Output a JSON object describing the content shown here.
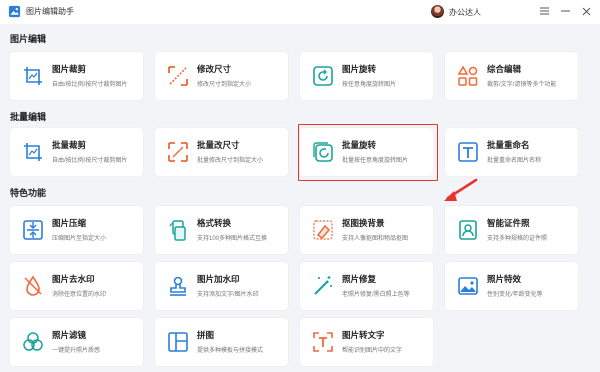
{
  "app": {
    "title": "图片编辑助手",
    "user": "办公达人"
  },
  "colors": {
    "accent_teal": "#1aa3a0",
    "accent_orange": "#f06a3a",
    "accent_blue": "#2b7fd8",
    "highlight": "#e8332e"
  },
  "sections": [
    {
      "title": "图片编辑"
    },
    {
      "title": "批量编辑"
    },
    {
      "title": "特色功能"
    }
  ],
  "cards": {
    "crop": {
      "title": "图片裁剪",
      "desc": "自由/按比例/按尺寸裁剪图片",
      "icon": "crop-icon"
    },
    "resize": {
      "title": "修改尺寸",
      "desc": "修改尺寸到指定大小",
      "icon": "resize-icon"
    },
    "rotate": {
      "title": "图片旋转",
      "desc": "按任意角度旋转图片",
      "icon": "rotate-icon"
    },
    "combo": {
      "title": "综合编辑",
      "desc": "裁剪/文字/滤镜等多个功能",
      "icon": "grid-shapes-icon"
    },
    "batch_crop": {
      "title": "批量裁剪",
      "desc": "自由/按比例/按尺寸裁剪图片",
      "icon": "crop-icon"
    },
    "batch_resize": {
      "title": "批量改尺寸",
      "desc": "批量修改尺寸到指定大小",
      "icon": "resize-icon"
    },
    "batch_rotate": {
      "title": "批量旋转",
      "desc": "批量按任意角度旋转图片",
      "icon": "rotate-icon"
    },
    "batch_rename": {
      "title": "批量重命名",
      "desc": "批量重命名图片名称",
      "icon": "text-t-icon"
    },
    "compress": {
      "title": "图片压缩",
      "desc": "压缩图片至指定大小",
      "icon": "compress-icon"
    },
    "convert": {
      "title": "格式转换",
      "desc": "支持100多种图片格式互换",
      "icon": "convert-icon"
    },
    "bg_replace": {
      "title": "抠图换背景",
      "desc": "支持人像抠图和物品抠图",
      "icon": "eraser-icon"
    },
    "id_photo": {
      "title": "智能证件照",
      "desc": "支持多种规格的证件照",
      "icon": "id-photo-icon"
    },
    "watermark_remove": {
      "title": "图片去水印",
      "desc": "消除任意位置的水印",
      "icon": "drop-remove-icon"
    },
    "watermark_add": {
      "title": "图片加水印",
      "desc": "支持添加文字/图片水印",
      "icon": "stamp-icon"
    },
    "restore": {
      "title": "照片修复",
      "desc": "老照片修复/黑白照上色等",
      "icon": "magic-wand-icon"
    },
    "effects": {
      "title": "照片特效",
      "desc": "性别变化/年龄变化等",
      "icon": "landscape-icon"
    },
    "filter": {
      "title": "照片滤镜",
      "desc": "一键提升照片质感",
      "icon": "filter-circles-icon"
    },
    "collage": {
      "title": "拼图",
      "desc": "提供多种模板与拼接模式",
      "icon": "collage-icon"
    },
    "ocr": {
      "title": "图片转文字",
      "desc": "帮能识别图片中的文字",
      "icon": "ocr-icon"
    }
  }
}
